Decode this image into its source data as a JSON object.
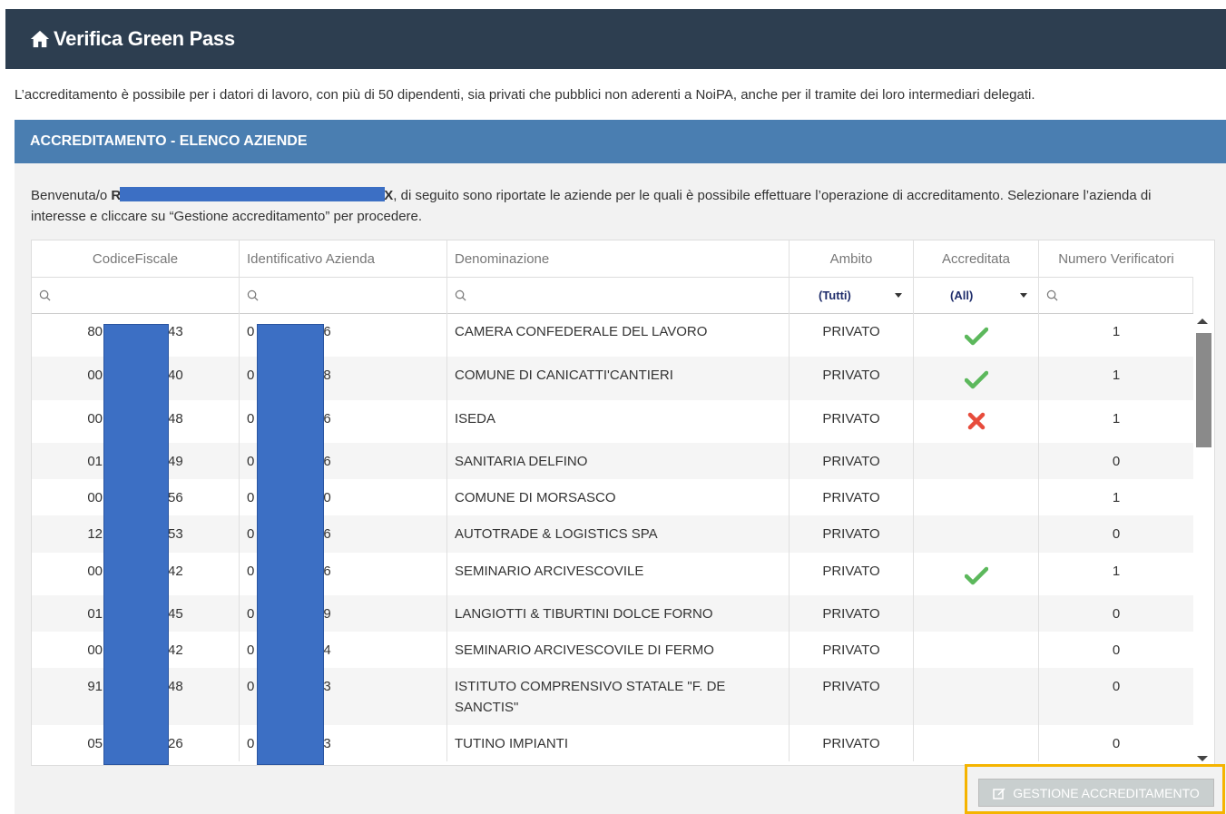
{
  "app": {
    "title": "Verifica Green Pass",
    "home_icon": "home-icon"
  },
  "intro": "L’accreditamento è possibile per i datori di lavoro, con più di 50 dipendenti, sia privati che pubblici non aderenti a NoiPA, anche per il tramite dei loro intermediari delegati.",
  "section": {
    "title": "ACCREDITAMENTO - ELENCO AZIENDE"
  },
  "welcome": {
    "prefix": "Benvenuta/o ",
    "name_start": "R",
    "name_end": "X",
    "rest": ", di seguito sono riportate le aziende per le quali è possibile effettuare l’operazione di accreditamento. Selezionare l’azienda di interesse e cliccare su “Gestione accreditamento” per procedere."
  },
  "table": {
    "columns": [
      "CodiceFiscale",
      "Identificativo Azienda",
      "Denominazione",
      "Ambito",
      "Accreditata",
      "Numero Verificatori"
    ],
    "filters": {
      "ambito": "(Tutti)",
      "accreditata": "(All)"
    },
    "rows": [
      {
        "cf_start": "80",
        "cf_end": "43",
        "id_start": "0",
        "id_end": "6",
        "name": "CAMERA CONFEDERALE DEL LAVORO",
        "ambito": "PRIVATO",
        "accreditata": "yes",
        "num": "1"
      },
      {
        "cf_start": "00",
        "cf_end": "40",
        "id_start": "0",
        "id_end": "8",
        "name": "COMUNE DI CANICATTI'CANTIERI",
        "ambito": "PRIVATO",
        "accreditata": "yes",
        "num": "1"
      },
      {
        "cf_start": "00",
        "cf_end": "48",
        "id_start": "0",
        "id_end": "6",
        "name": "ISEDA",
        "ambito": "PRIVATO",
        "accreditata": "no",
        "num": "1"
      },
      {
        "cf_start": "01",
        "cf_end": "49",
        "id_start": "0",
        "id_end": "6",
        "name": "SANITARIA DELFINO",
        "ambito": "PRIVATO",
        "accreditata": "",
        "num": "0"
      },
      {
        "cf_start": "00",
        "cf_end": "56",
        "id_start": "0",
        "id_end": "0",
        "name": "COMUNE DI MORSASCO",
        "ambito": "PRIVATO",
        "accreditata": "",
        "num": "1"
      },
      {
        "cf_start": "12",
        "cf_end": "53",
        "id_start": "0",
        "id_end": "6",
        "name": "AUTOTRADE & LOGISTICS SPA",
        "ambito": "PRIVATO",
        "accreditata": "",
        "num": "0"
      },
      {
        "cf_start": "00",
        "cf_end": "42",
        "id_start": "0",
        "id_end": "6",
        "name": "SEMINARIO ARCIVESCOVILE",
        "ambito": "PRIVATO",
        "accreditata": "yes",
        "num": "1"
      },
      {
        "cf_start": "01",
        "cf_end": "45",
        "id_start": "0",
        "id_end": "9",
        "name": "LANGIOTTI & TIBURTINI DOLCE FORNO",
        "ambito": "PRIVATO",
        "accreditata": "",
        "num": "0"
      },
      {
        "cf_start": "00",
        "cf_end": "42",
        "id_start": "0",
        "id_end": "4",
        "name": "SEMINARIO ARCIVESCOVILE DI FERMO",
        "ambito": "PRIVATO",
        "accreditata": "",
        "num": "0"
      },
      {
        "cf_start": "91",
        "cf_end": "48",
        "id_start": "0",
        "id_end": "3",
        "name": "ISTITUTO COMPRENSIVO STATALE \"F. DE SANCTIS\"",
        "ambito": "PRIVATO",
        "accreditata": "",
        "num": "0"
      },
      {
        "cf_start": "05",
        "cf_end": "26",
        "id_start": "0",
        "id_end": "3",
        "name": "TUTINO IMPIANTI",
        "ambito": "PRIVATO",
        "accreditata": "",
        "num": "0"
      }
    ]
  },
  "actions": {
    "gestione_label": "GESTIONE ACCREDITAMENTO",
    "gestione_icon": "edit-icon"
  },
  "colors": {
    "topbar": "#2d3e50",
    "section": "#4a7eb1",
    "check": "#5cb85c",
    "cross": "#e74c3c",
    "highlight": "#f5b400"
  }
}
